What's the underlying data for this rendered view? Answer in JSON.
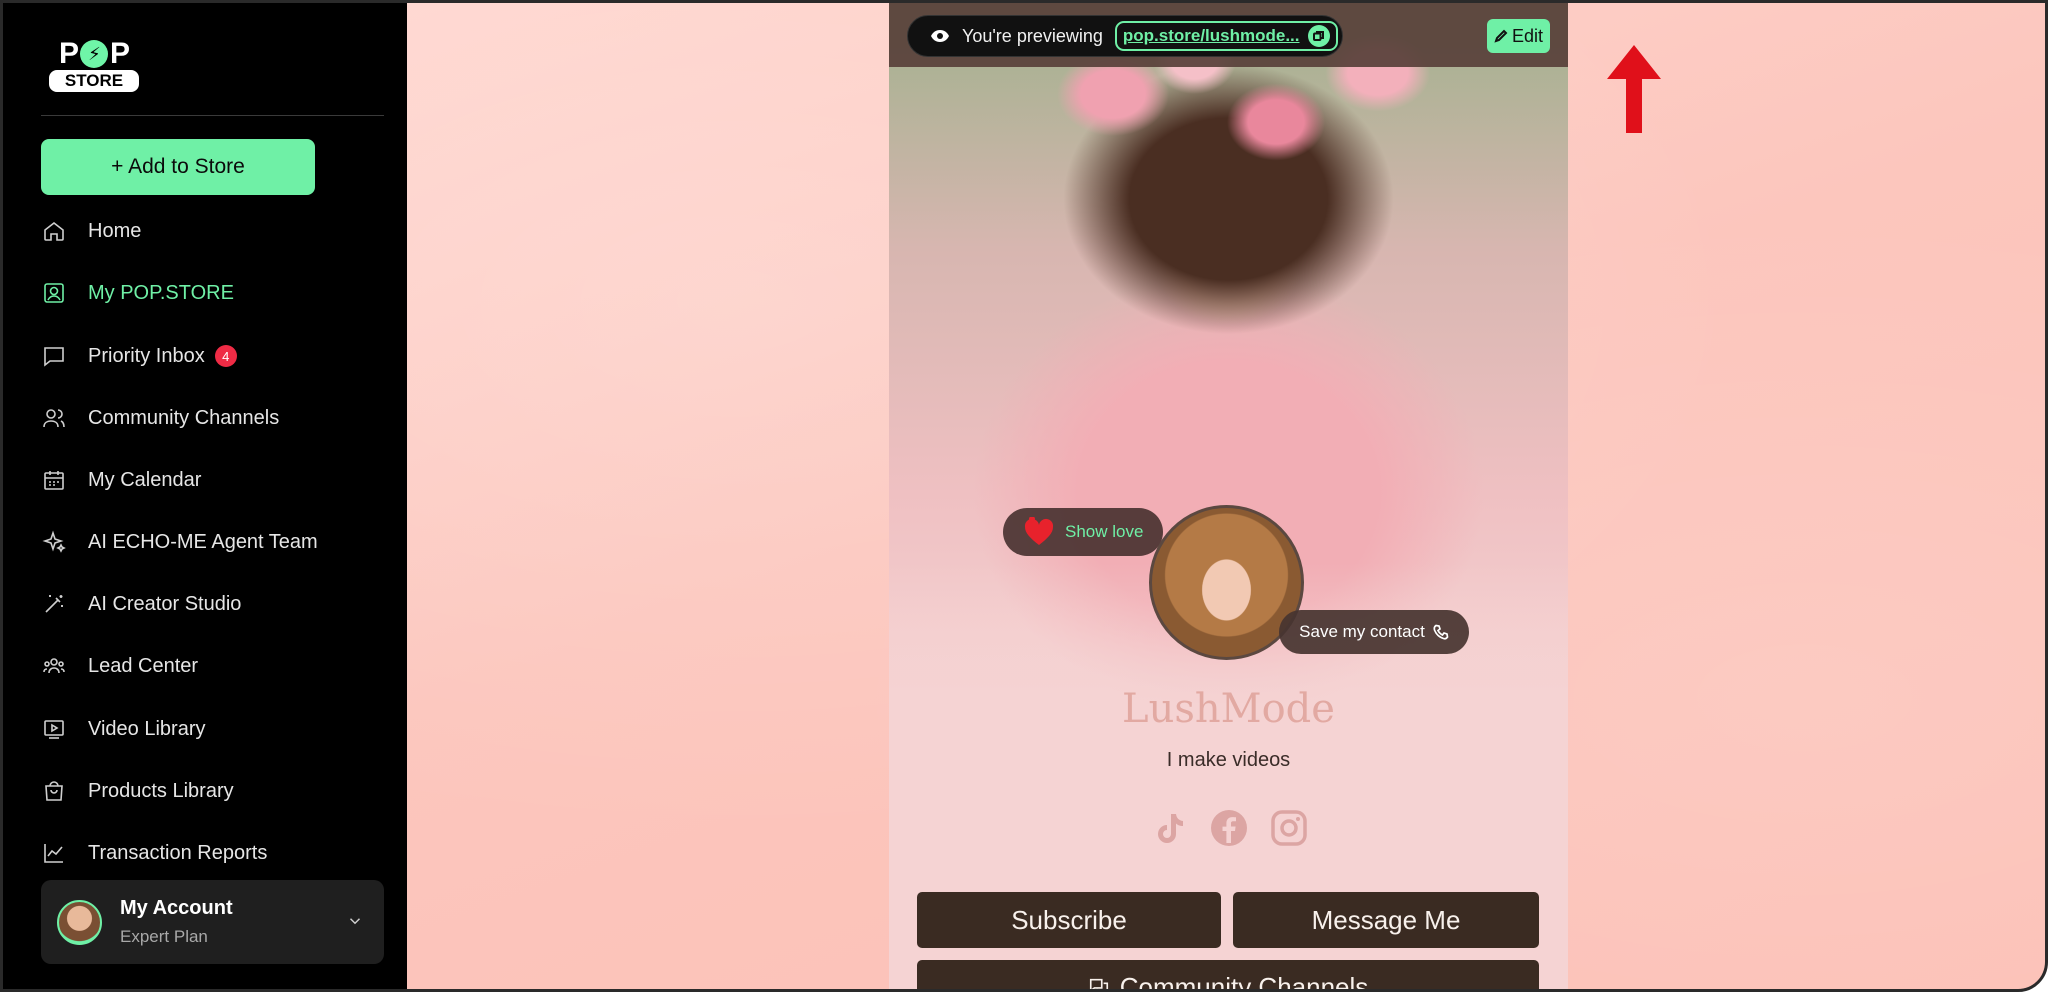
{
  "sidebar": {
    "logo": {
      "top": "P P",
      "bottom": "STORE"
    },
    "add_button": "+ Add to Store",
    "items": [
      {
        "label": "Home",
        "icon": "home-icon"
      },
      {
        "label": "My POP.STORE",
        "icon": "user-square-icon",
        "active": true
      },
      {
        "label": "Priority Inbox",
        "icon": "chat-icon",
        "badge": "4"
      },
      {
        "label": "Community Channels",
        "icon": "users-icon"
      },
      {
        "label": "My Calendar",
        "icon": "calendar-icon"
      },
      {
        "label": "AI ECHO-ME Agent Team",
        "icon": "sparkle-icon"
      },
      {
        "label": "AI Creator Studio",
        "icon": "magic-wand-icon"
      },
      {
        "label": "Lead Center",
        "icon": "group-icon"
      },
      {
        "label": "Video Library",
        "icon": "video-icon"
      },
      {
        "label": "Products Library",
        "icon": "bag-icon"
      },
      {
        "label": "Transaction Reports",
        "icon": "chart-line-icon"
      }
    ],
    "account": {
      "name": "My Account",
      "plan": "Expert Plan"
    }
  },
  "preview": {
    "label": "You're previewing",
    "link": "pop.store/lushmode...",
    "edit": "Edit"
  },
  "profile": {
    "show_love": "Show love",
    "save_contact": "Save my contact",
    "name": "LushMode",
    "bio": "I make videos",
    "socials": [
      "tiktok-icon",
      "facebook-icon",
      "instagram-icon"
    ]
  },
  "buttons": {
    "subscribe": "Subscribe",
    "message": "Message Me",
    "community": "Community Channels"
  },
  "colors": {
    "accent": "#6ff0a6",
    "sidebar_bg": "#000000",
    "button_bg": "#3a2b22",
    "badge": "#ef2b45",
    "annotation_arrow": "#e0101a"
  }
}
